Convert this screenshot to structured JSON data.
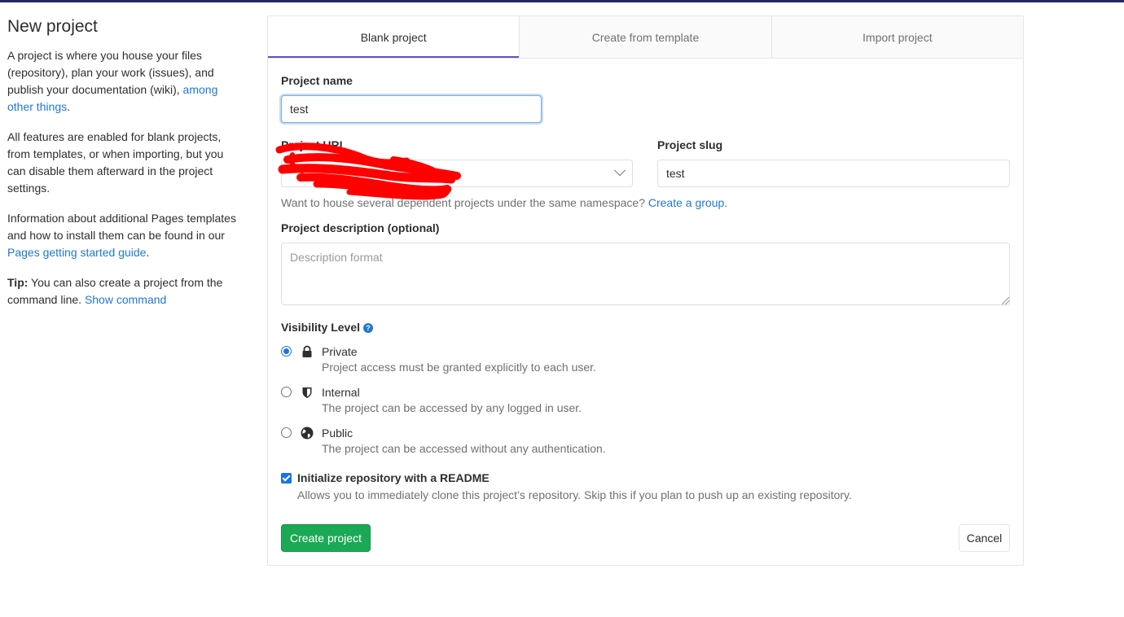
{
  "info": {
    "title": "New project",
    "p1_text": "A project is where you house your files (repository), plan your work (issues), and publish your documentation (wiki),",
    "p1_link": "among other things",
    "p2_text": "All features are enabled for blank projects, from templates, or when importing, but you can disable them afterward in the project settings.",
    "p3_text": "Information about additional Pages templates and how to install them can be found in our",
    "p3_link": "Pages getting started guide",
    "tip_label": "Tip:",
    "tip_text": "You can also create a project from the command line.",
    "tip_link": "Show command"
  },
  "tabs": [
    {
      "label": "Blank project",
      "active": true
    },
    {
      "label": "Create from template",
      "active": false
    },
    {
      "label": "Import project",
      "active": false
    }
  ],
  "form": {
    "project_name_label": "Project name",
    "project_name_value": "test",
    "project_url_label": "Project URL",
    "project_slug_label": "Project slug",
    "project_slug_value": "test",
    "namespace_help": "Want to house several dependent projects under the same namespace?",
    "namespace_link": "Create a group.",
    "description_label": "Project description (optional)",
    "description_placeholder": "Description format",
    "visibility_label": "Visibility Level",
    "visibility_options": [
      {
        "title": "Private",
        "desc": "Project access must be granted explicitly to each user.",
        "icon": "lock-icon",
        "checked": true
      },
      {
        "title": "Internal",
        "desc": "The project can be accessed by any logged in user.",
        "icon": "shield-icon",
        "checked": false
      },
      {
        "title": "Public",
        "desc": "The project can be accessed without any authentication.",
        "icon": "globe-icon",
        "checked": false
      }
    ],
    "readme_label": "Initialize repository with a README",
    "readme_help": "Allows you to immediately clone this project’s repository. Skip this if you plan to push up an existing repository.",
    "readme_checked": true,
    "create_button": "Create project",
    "cancel_button": "Cancel"
  },
  "colors": {
    "topbar": "#292961",
    "link": "#1f78d1",
    "success": "#1aaa55",
    "tab_active_border": "#6b4fbb",
    "redaction": "#ff0000"
  }
}
